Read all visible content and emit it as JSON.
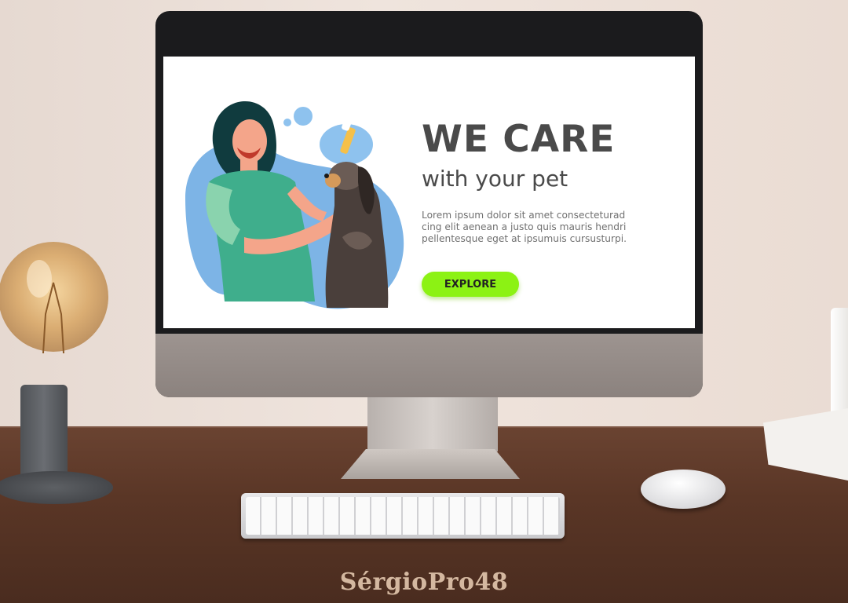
{
  "hero": {
    "title": "WE CARE",
    "subtitle": "with your pet",
    "body_lines": [
      "Lorem ipsum dolor sit amet consecteturad",
      "cing elit aenean a justo quis mauris hendri",
      "pellentesque eget at ipsumuis cursusturpi."
    ],
    "cta_label": "EXPLORE"
  },
  "watermark": "SérgioPro48",
  "colors": {
    "accent": "#8cf214",
    "heading": "#4a4a4a",
    "blob": "#7db4e6",
    "scrub": "#3fae8c"
  },
  "icons": {
    "illustration": "woman-with-dog-illustration"
  }
}
